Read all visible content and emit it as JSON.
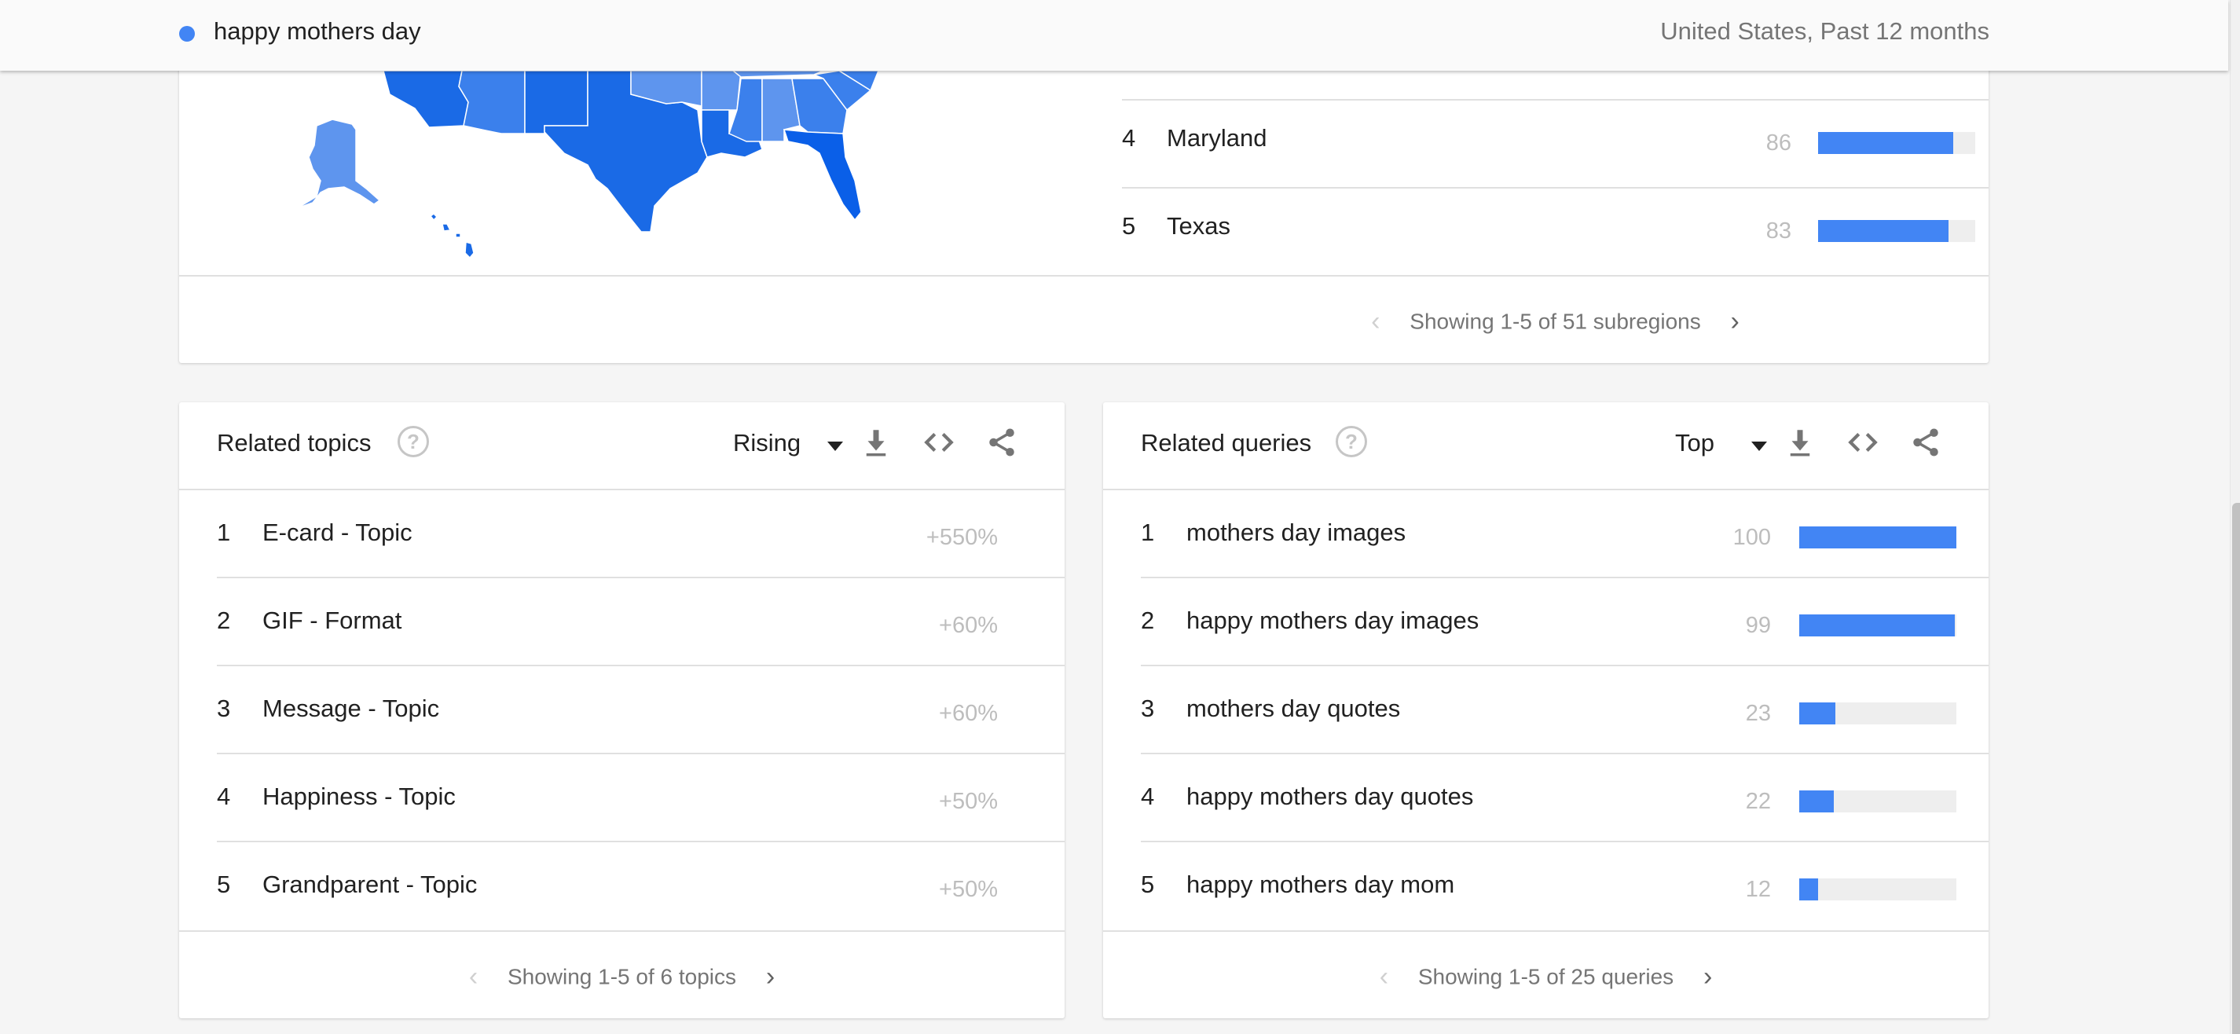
{
  "header": {
    "search_term": "happy mothers day",
    "term_color": "#4285f4",
    "scope": "United States, Past 12 months"
  },
  "subregions": {
    "rows": [
      {
        "rank": "4",
        "name": "Maryland",
        "value": "86",
        "fraction": 0.86
      },
      {
        "rank": "5",
        "name": "Texas",
        "value": "83",
        "fraction": 0.83
      }
    ],
    "pager_text": "Showing 1-5 of 51 subregions"
  },
  "related_topics": {
    "title": "Related topics",
    "help_icon": "?",
    "mode": "Rising",
    "icons": [
      "download-icon",
      "embed-code-icon",
      "share-icon"
    ],
    "rows": [
      {
        "rank": "1",
        "name": "E-card - Topic",
        "value": "+550%"
      },
      {
        "rank": "2",
        "name": "GIF - Format",
        "value": "+60%"
      },
      {
        "rank": "3",
        "name": "Message - Topic",
        "value": "+60%"
      },
      {
        "rank": "4",
        "name": "Happiness - Topic",
        "value": "+50%"
      },
      {
        "rank": "5",
        "name": "Grandparent - Topic",
        "value": "+50%"
      }
    ],
    "pager_text": "Showing 1-5 of 6 topics"
  },
  "related_queries": {
    "title": "Related queries",
    "help_icon": "?",
    "mode": "Top",
    "icons": [
      "download-icon",
      "embed-code-icon",
      "share-icon"
    ],
    "rows": [
      {
        "rank": "1",
        "name": "mothers day images",
        "value": "100",
        "fraction": 1.0
      },
      {
        "rank": "2",
        "name": "happy mothers day images",
        "value": "99",
        "fraction": 0.99
      },
      {
        "rank": "3",
        "name": "mothers day quotes",
        "value": "23",
        "fraction": 0.23
      },
      {
        "rank": "4",
        "name": "happy mothers day quotes",
        "value": "22",
        "fraction": 0.22
      },
      {
        "rank": "5",
        "name": "happy mothers day mom",
        "value": "12",
        "fraction": 0.12
      }
    ],
    "pager_text": "Showing 1-5 of 25 queries"
  },
  "pager": {
    "prev": "‹",
    "next": "›"
  },
  "colors": {
    "bar": "#4285f4",
    "bar_track": "#eeeeee",
    "map_dark": "#1a6ae6",
    "map_mid": "#3b80ec",
    "map_light": "#5e95ee"
  }
}
